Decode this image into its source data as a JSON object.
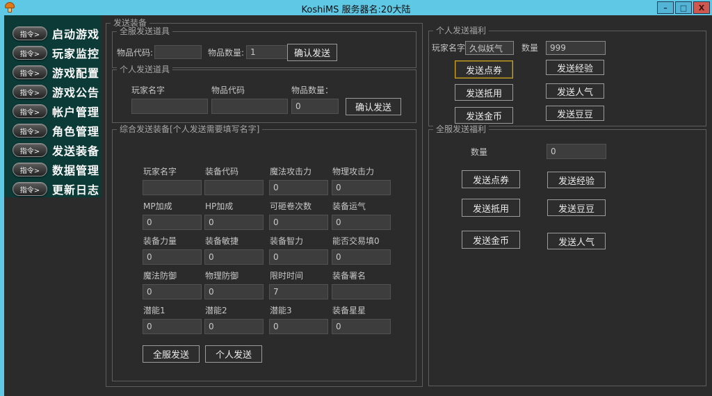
{
  "window": {
    "title": "KoshiMS 服务器名:20大陆",
    "controls": {
      "minimize": "–",
      "maximize": "□",
      "close": "X"
    },
    "app_icon": "orange-mushroom-character"
  },
  "colors": {
    "titlebar": "#5fc8e4",
    "sidebar": "#0c3a37",
    "background": "#2b2b2b",
    "focus_gold": "#c9a227",
    "close_red": "#cf5950"
  },
  "sidebar": {
    "command_label": "指令>",
    "items": [
      {
        "label": "启动游戏"
      },
      {
        "label": "玩家监控"
      },
      {
        "label": "游戏配置"
      },
      {
        "label": "游戏公告"
      },
      {
        "label": "帐户管理"
      },
      {
        "label": "角色管理"
      },
      {
        "label": "发送装备"
      },
      {
        "label": "数据管理"
      },
      {
        "label": "更新日志"
      }
    ]
  },
  "send_equipment": {
    "title": "发送装备",
    "server_send_item": {
      "title": "全服发送道具",
      "item_code_label": "物品代码:",
      "item_code_value": "",
      "item_qty_label": "物品数量:",
      "item_qty_value": "1",
      "confirm_button": "确认发送"
    },
    "personal_send_item": {
      "title": "个人发送道具",
      "player_name_label": "玩家名字",
      "player_name_value": "",
      "item_code_label": "物品代码",
      "item_code_value": "",
      "item_qty_label": "物品数量：",
      "item_qty_value": "0",
      "confirm_button": "确认发送"
    },
    "composite_send": {
      "title": "综合发送装备[个人发送需要填写名字]",
      "fields": [
        {
          "label": "玩家名字",
          "value": ""
        },
        {
          "label": "装备代码",
          "value": ""
        },
        {
          "label": "魔法攻击力",
          "value": "0"
        },
        {
          "label": "物理攻击力",
          "value": "0"
        },
        {
          "label": "MP加成",
          "value": "0"
        },
        {
          "label": "HP加成",
          "value": "0"
        },
        {
          "label": "可砸卷次数",
          "value": "0"
        },
        {
          "label": "装备运气",
          "value": "0"
        },
        {
          "label": "装备力量",
          "value": "0"
        },
        {
          "label": "装备敏捷",
          "value": "0"
        },
        {
          "label": "装备智力",
          "value": "0"
        },
        {
          "label": "能否交易填0",
          "value": "0"
        },
        {
          "label": "魔法防御",
          "value": "0"
        },
        {
          "label": "物理防御",
          "value": "0"
        },
        {
          "label": "限时时间",
          "value": "7"
        },
        {
          "label": "装备署名",
          "value": ""
        },
        {
          "label": "潜能1",
          "value": "0"
        },
        {
          "label": "潜能2",
          "value": "0"
        },
        {
          "label": "潜能3",
          "value": "0"
        },
        {
          "label": "装备星星",
          "value": "0"
        }
      ],
      "server_send_button": "全服发送",
      "personal_send_button": "个人发送"
    }
  },
  "personal_welfare": {
    "title": "个人发送福利",
    "player_name_label": "玩家名字",
    "player_name_value": "久似妖气",
    "qty_label": "数量",
    "qty_value": "999",
    "buttons_left": [
      "发送点券",
      "发送抵用",
      "发送金币"
    ],
    "buttons_right": [
      "发送经验",
      "发送人气",
      "发送豆豆"
    ]
  },
  "server_welfare": {
    "title": "全服发送福利",
    "qty_label": "数量",
    "qty_value": "0",
    "buttons_left": [
      "发送点券",
      "发送抵用",
      "发送金币"
    ],
    "buttons_right": [
      "发送经验",
      "发送豆豆",
      "发送人气"
    ]
  }
}
